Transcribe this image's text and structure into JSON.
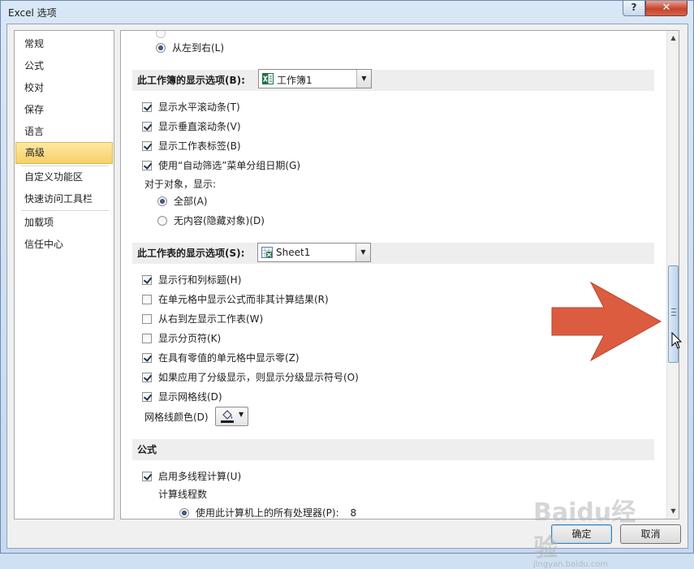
{
  "window": {
    "title": "Excel 选项",
    "help_label": "?",
    "close_label": "✕"
  },
  "sidebar": {
    "items": [
      {
        "label": "常规"
      },
      {
        "label": "公式"
      },
      {
        "label": "校对"
      },
      {
        "label": "保存"
      },
      {
        "label": "语言"
      },
      {
        "label": "高级",
        "active": true
      },
      {
        "label": "自定义功能区"
      },
      {
        "label": "快速访问工具栏"
      },
      {
        "label": "加载项"
      },
      {
        "label": "信任中心"
      }
    ]
  },
  "content": {
    "top_partial_label": "从左到右(L)",
    "workbook_section": {
      "title": "此工作簿的显示选项(B):",
      "combo_value": "工作簿1",
      "options": [
        {
          "label": "显示水平滚动条(T)",
          "checked": true
        },
        {
          "label": "显示垂直滚动条(V)",
          "checked": true
        },
        {
          "label": "显示工作表标签(B)",
          "checked": true
        },
        {
          "label": "使用“自动筛选”菜单分组日期(G)",
          "checked": true
        }
      ],
      "objects_label": "对于对象，显示:",
      "objects_options": [
        {
          "label": "全部(A)",
          "checked": true
        },
        {
          "label": "无内容(隐藏对象)(D)",
          "checked": false
        }
      ]
    },
    "worksheet_section": {
      "title": "此工作表的显示选项(S):",
      "combo_value": "Sheet1",
      "options": [
        {
          "label": "显示行和列标题(H)",
          "checked": true
        },
        {
          "label": "在单元格中显示公式而非其计算结果(R)",
          "checked": false
        },
        {
          "label": "从右到左显示工作表(W)",
          "checked": false
        },
        {
          "label": "显示分页符(K)",
          "checked": false
        },
        {
          "label": "在具有零值的单元格中显示零(Z)",
          "checked": true
        },
        {
          "label": "如果应用了分级显示，则显示分级显示符号(O)",
          "checked": true
        },
        {
          "label": "显示网格线(D)",
          "checked": true
        }
      ],
      "gridline_color_label": "网格线颜色(D)"
    },
    "formula_section": {
      "title": "公式",
      "multithread_label": "启用多线程计算(U)",
      "multithread_checked": true,
      "threads_label": "计算线程数",
      "use_all_label": "使用此计算机上的所有处理器(P):",
      "use_all_value": "8"
    }
  },
  "footer": {
    "ok_label": "确定",
    "cancel_label": "取消"
  },
  "watermark": {
    "text": "Baidu经验",
    "sub": "jingyan.baidu.com"
  },
  "colors": {
    "active_nav": "#f8d06b",
    "overlay_arrow": "#dc5c40"
  }
}
